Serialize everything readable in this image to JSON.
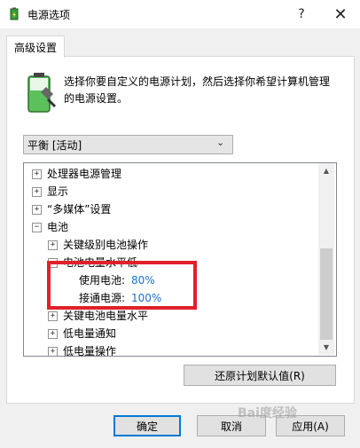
{
  "window": {
    "title": "电源选项",
    "help_glyph": "?",
    "close_glyph": "✕"
  },
  "tab": {
    "label": "高级设置"
  },
  "description": "选择你要自定义的电源计划，然后选择你希望计算机管理的电源设置。",
  "plan_select": {
    "value": "平衡 [活动]"
  },
  "tree": {
    "items": [
      {
        "label": "处理器电源管理",
        "expander": "+"
      },
      {
        "label": "显示",
        "expander": "+"
      },
      {
        "label": "“多媒体”设置",
        "expander": "+"
      },
      {
        "label": "电池",
        "expander": "−"
      },
      {
        "label": "关键级别电池操作",
        "expander": "+"
      },
      {
        "label": "电池电量水平低",
        "expander": "−"
      },
      {
        "label": "使用电池:",
        "value": "80%"
      },
      {
        "label": "接通电源:",
        "value": "100%"
      },
      {
        "label": "关键电池电量水平",
        "expander": "+"
      },
      {
        "label": "低电量通知",
        "expander": "+"
      },
      {
        "label": "低电量操作",
        "expander": "+"
      }
    ]
  },
  "buttons": {
    "restore": "还原计划默认值(R)",
    "ok": "确定",
    "cancel": "取消",
    "apply": "应用(A)"
  },
  "watermark": "Bai度经验",
  "colors": {
    "value_text": "#1a6fd0",
    "highlight_box": "#e0202a",
    "default_button_border": "#0078d7"
  }
}
